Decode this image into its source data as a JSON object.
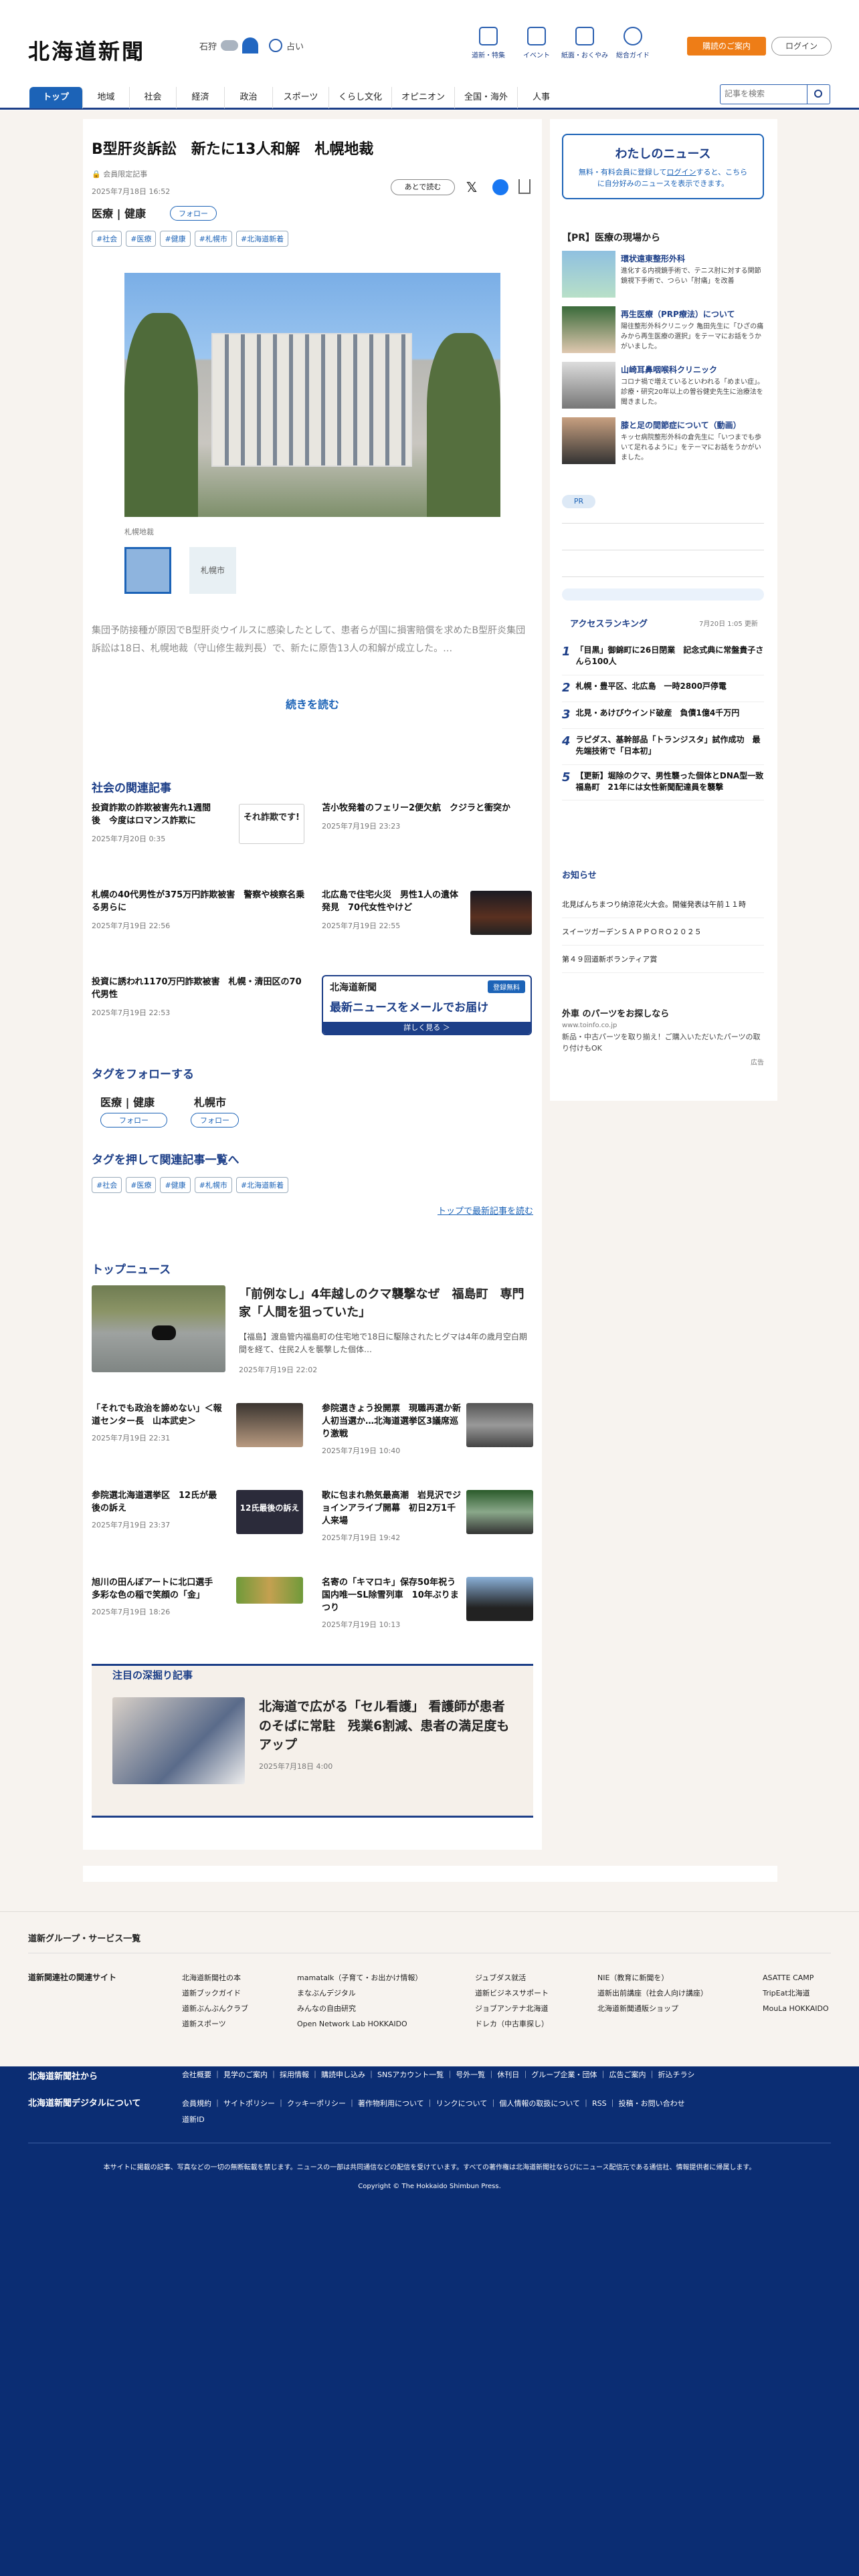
{
  "header": {
    "logo": "北海道新聞",
    "weather_city": "石狩",
    "weather_other": "占い",
    "tools": [
      {
        "label": "道新・特集"
      },
      {
        "label": "イベント"
      },
      {
        "label": "紙面・おくやみ"
      },
      {
        "label": "総合ガイド"
      }
    ],
    "cta": "購読のご案内",
    "login": "ログイン"
  },
  "nav": {
    "items": [
      "トップ",
      "地域",
      "社会",
      "経済",
      "政治",
      "スポーツ",
      "くらし文化",
      "オピニオン",
      "全国・海外",
      "人事"
    ],
    "search_placeholder": "記事を検索"
  },
  "article": {
    "title": "B型肝炎訴訟　新たに13人和解　札幌地裁",
    "access": "会員限定記事",
    "date": "2025年7月18日 16:52",
    "save": "あとで読む",
    "topic1": "医療",
    "topic2": "健康",
    "follow": "フォロー",
    "tags": [
      "#社会",
      "#医療",
      "#健康",
      "#札幌市",
      "#北海道新着"
    ],
    "caption": "札幌地裁",
    "thumb2": "札幌市",
    "body": "集団予防接種が原因でB型肝炎ウイルスに感染したとして、患者らが国に損害賠償を求めたB型肝炎集団訴訟は18日、札幌地裁（守山修生裁判長）で、新たに原告13人の和解が成立した。…",
    "read_more": "続きを読む"
  },
  "related": {
    "title": "社会の関連記事",
    "items": [
      {
        "title": "投資詐欺の詐欺被害先れ1週間後　今度はロマンス詐欺に",
        "date": "2025年7月20日 0:35"
      },
      {
        "title": "苫小牧発着のフェリー2便欠航　クジラと衝突か",
        "date": "2025年7月19日 23:23"
      },
      {
        "title": "札幌の40代男性が375万円詐欺被害　警察や検察名乗る男らに",
        "date": "2025年7月19日 22:56"
      },
      {
        "title": "北広島で住宅火災　男性1人の遺体発見　70代女性やけど",
        "date": "2025年7月19日 22:55"
      },
      {
        "title": "投資に誘われ1170万円詐欺被害　札幌・清田区の70代男性",
        "date": "2025年7月19日 22:53"
      }
    ],
    "thumb_text": "それ詐欺です!",
    "promo": {
      "brand": "北海道新聞",
      "badge": "登録無料",
      "title": "最新ニュースをメールでお届け",
      "link": "詳しく見る ＞"
    }
  },
  "follow_tags": {
    "title": "タグをフォローする",
    "tags": [
      {
        "name": "医療",
        "name2": "健康",
        "btn": "フォロー"
      },
      {
        "name": "札幌市",
        "btn": "フォロー"
      }
    ]
  },
  "tag_list": {
    "title": "タグを押して関連記事一覧へ",
    "tags": [
      "#社会",
      "#医療",
      "#健康",
      "#札幌市",
      "#北海道新着"
    ],
    "more": "トップで最新記事を読む"
  },
  "top_news": {
    "title": "トップニュース",
    "lead": {
      "title": "「前例なし」4年越しのクマ襲撃なぜ　福島町　専門家「人間を狙っていた」",
      "summary": "【福島】渡島管内福島町の住宅地で18日に駆除されたヒグマは4年の歳月空白期間を経て、住民2人を襲撃した個体…",
      "date": "2025年7月19日 22:02"
    },
    "items": [
      {
        "title": "「それでも政治を諦めない」＜報道センター長　山本武史＞",
        "date": "2025年7月19日 22:31"
      },
      {
        "title": "参院選きょう投開票　現職再選か新人初当選か…北海道選挙区3議席巡り激戦",
        "date": "2025年7月19日 10:40"
      },
      {
        "title": "参院選北海道選挙区　12氏が最後の訴え",
        "date": "2025年7月19日 23:37"
      },
      {
        "title": "歌に包まれ熱気最高潮　岩見沢でジョインアライブ開幕　初日2万1千人来場",
        "date": "2025年7月19日 19:42"
      },
      {
        "title": "旭川の田んぼアートに北口選手　多彩な色の稲で笑顔の「金」",
        "date": "2025年7月19日 18:26"
      },
      {
        "title": "名寄の「キマロキ」保存50年祝う　国内唯一SL除雪列車　10年ぶりまつり",
        "date": "2025年7月19日 10:13"
      }
    ],
    "thumb_text": "12氏最後の訴え"
  },
  "feature": {
    "label": "注目の深掘り記事",
    "title": "北海道で広がる「セル看護」 看護師が患者のそばに常駐　残業6割減、患者の満足度もアップ",
    "date": "2025年7月18日 4:00"
  },
  "sidebar": {
    "mynews": {
      "title": "わたしのニュース",
      "text1": "無料・有料会員に登録して",
      "login": "ログイン",
      "text2": "すると、こちらに自分好みのニュースを表示できます。"
    },
    "pr_title": "【PR】医療の現場から",
    "pr_items": [
      {
        "title": "環状遠東整形外科",
        "desc": "進化する内視鏡手術で、テニス肘に対する関節鏡視下手術で、つらい「肘痛」を改善"
      },
      {
        "title": "再生医療（PRP療法）について",
        "desc": "陽往整形外科クリニック 亀田先生に「ひざの痛みから再生医療の選択」をテーマにお話をうかがいました。"
      },
      {
        "title": "山崎耳鼻咽喉科クリニック",
        "desc": "コロナ禍で増えているといわれる「めまい症」。診療・研究20年以上の曽谷健史先生に治療法を聞きました。"
      },
      {
        "title": "膝と足の間節症について（動画）",
        "desc": "キッセ病院整形外科の倉先生に「いつまでも歩いて足れるように」をテーマにお話をうかがいました。"
      }
    ],
    "pr_badge": "PR",
    "ranking": {
      "title": "アクセスランキング",
      "time": "7月20日 1:05 更新",
      "items": [
        "「目黒」御錦町に26日閉業　記念式典に常盤貴子さんら100人",
        "札幌・豊平区、北広島　一時2800戸停電",
        "北見・あけびウインド破産　負債1億4千万円",
        "ラピダス、基幹部品「トランジスタ」試作成功　最先端技術で「日本初」",
        "【更新】堀除のクマ、男性襲った個体とDNA型一致　福島町　21年には女性新聞配達員を襲撃"
      ]
    },
    "notice": {
      "title": "お知らせ",
      "items": [
        "北見ばんちまつり納涼花火大会。開催発表は午前１１時",
        "スイーツガーデンＳＡＰＰＯＲＯ２０２５",
        "第４９回道新ボランティア賞",
        ""
      ]
    },
    "ad": {
      "title": "外車 のパーツをお探しなら",
      "url": "www.toinfo.co.jp",
      "desc": "新品・中古パーツを取り揃え！ご購入いただいたパーツの取り付けもOK",
      "label": "広告"
    }
  },
  "footer": {
    "group_link": "道新グループ・サービス一覧",
    "related_label": "道新関連社の関連サイト",
    "cols": [
      [
        "北海道新聞社の本",
        "道新ブックガイド",
        "道新ぶんぶんクラブ",
        "道新スポーツ"
      ],
      [
        "mamatalk（子育て・お出かけ情報）",
        "まなぶんデジタル",
        "みんなの自由研究",
        "Open Network Lab HOKKAIDO"
      ],
      [
        "ジュブダス就活",
        "道新ビジネスサポート",
        "ジョブアンテナ北海道",
        "ドレカ（中古車探し）"
      ],
      [
        "NIE（教育に新聞を）",
        "道新出前講座（社会人向け講座）",
        "北海道新聞通販ショップ",
        ""
      ],
      [
        "ASATTE CAMP",
        "TripEat北海道",
        "MouLa HOKKAIDO",
        ""
      ]
    ],
    "company": "北海道新聞社から",
    "digital": "北海道新聞デジタルについて",
    "links1": [
      "会社概要",
      "見学のご案内",
      "採用情報",
      "購読申し込み",
      "SNSアカウント一覧",
      "号外一覧",
      "休刊日",
      "グループ企業・団体",
      "広告ご案内",
      "折込チラシ"
    ],
    "links2": [
      "会員規約",
      "サイトポリシー",
      "クッキーポリシー",
      "著作物利用について",
      "リンクについて",
      "個人情報の取扱について",
      "RSS",
      "投稿・お問い合わせ",
      "道新ID"
    ],
    "notice": "本サイトに掲載の記事、写真などの一切の無断転載を禁じます。ニュースの一部は共同通信などの配信を受けています。すべての著作権は北海道新聞社ならびにニュース配信元である通信社、情報提供者に帰属します。",
    "copyright": "Copyright © The Hokkaido Shimbun Press."
  },
  "colors": {
    "navy": "#0b2d73",
    "accent": "#1c63b7",
    "orange": "#ee7d17"
  }
}
